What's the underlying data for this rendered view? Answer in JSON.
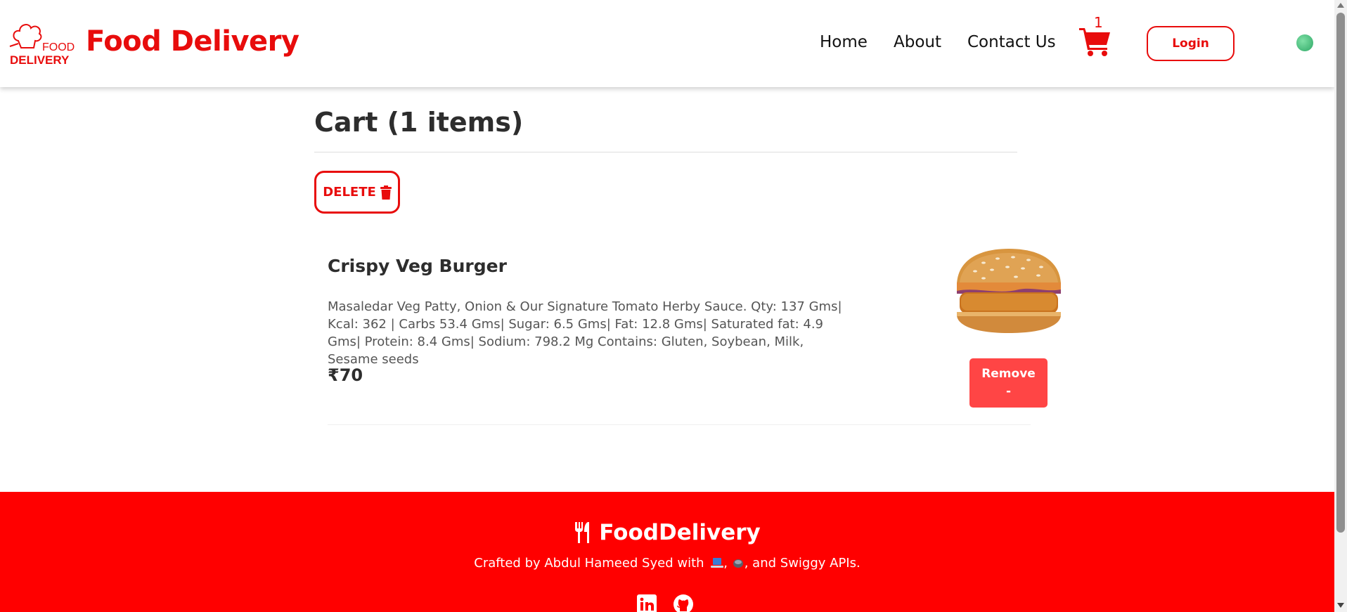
{
  "header": {
    "logo_text_top": "FOOD",
    "logo_text_bottom": "DELIVERY",
    "brand": "Food Delivery",
    "nav": {
      "home": "Home",
      "about": "About",
      "contact": "Contact Us"
    },
    "cart_count": "1",
    "login_label": "Login",
    "accent_color": "#e80c0c"
  },
  "cart": {
    "title": "Cart (1 items)",
    "delete_label": "DELETE",
    "items": [
      {
        "name": "Crispy Veg Burger",
        "description": "Masaledar Veg Patty, Onion & Our Signature Tomato Herby Sauce. Qty: 137 Gms| Kcal: 362 | Carbs 53.4 Gms| Sugar: 6.5 Gms| Fat: 12.8 Gms| Saturated fat: 4.9 Gms| Protein: 8.4 Gms| Sodium: 798.2 Mg Contains: Gluten, Soybean, Milk, Sesame seeds",
        "price": "₹70",
        "remove_label": "Remove",
        "remove_symbol": "-"
      }
    ]
  },
  "footer": {
    "brand": "FoodDelivery",
    "credit_prefix": "Crafted by Abdul Hameed Syed with",
    "credit_suffix": ", and Swiggy APIs.",
    "background": "#ff0000"
  }
}
